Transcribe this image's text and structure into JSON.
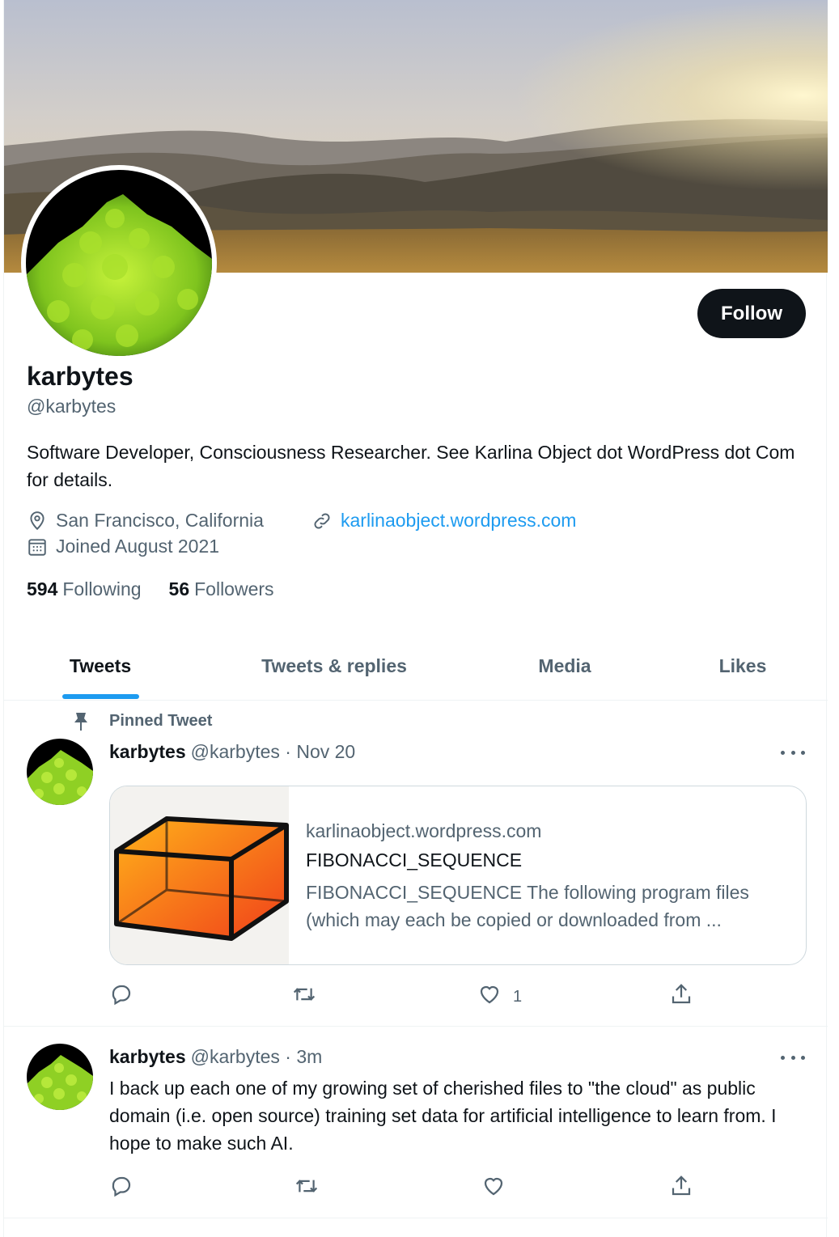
{
  "profile": {
    "display_name": "karbytes",
    "handle": "@karbytes",
    "bio": "Software Developer, Consciousness Researcher. See Karlina Object dot WordPress dot Com for details.",
    "location": "San Francisco, California",
    "website": "karlinaobject.wordpress.com",
    "joined": "Joined August 2021",
    "following_count": "594",
    "following_label": "Following",
    "followers_count": "56",
    "followers_label": "Followers",
    "follow_label": "Follow"
  },
  "tabs": [
    {
      "label": "Tweets",
      "active": true
    },
    {
      "label": "Tweets & replies",
      "active": false
    },
    {
      "label": "Media",
      "active": false
    },
    {
      "label": "Likes",
      "active": false
    }
  ],
  "tweets": [
    {
      "pinned_label": "Pinned Tweet",
      "name": "karbytes",
      "handle": "@karbytes",
      "time": "· Nov 20",
      "card": {
        "domain": "karlinaobject.wordpress.com",
        "title": "FIBONACCI_SEQUENCE",
        "description": "FIBONACCI_SEQUENCE The following program files (which may each be copied or downloaded from ..."
      },
      "like_count": "1"
    },
    {
      "name": "karbytes",
      "handle": "@karbytes",
      "time": "· 3m",
      "text": "I back up each one of my growing set of cherished files to \"the cloud\" as public domain (i.e. open source) training set data for artificial intelligence to learn from. I hope to make such AI."
    }
  ],
  "colors": {
    "accent": "#1d9bf0",
    "text_secondary": "#536471",
    "follow_bg": "#0f1419"
  }
}
